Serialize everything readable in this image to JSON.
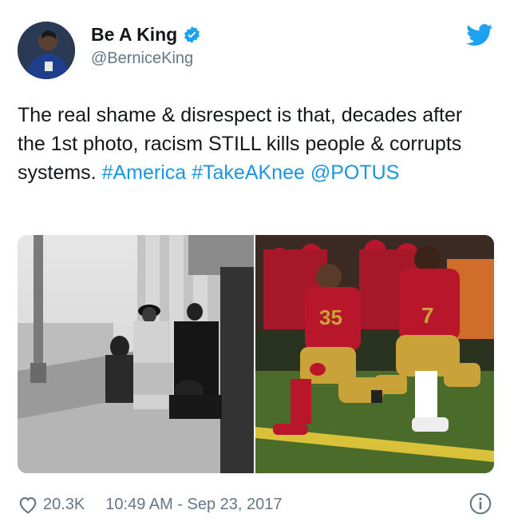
{
  "user": {
    "name": "Be A King",
    "handle": "@BerniceKing"
  },
  "tweet": {
    "text_plain": "The real shame & disrespect is that, decades after the 1st photo, racism STILL kills people & corrupts systems. ",
    "hashtag_1": "#America",
    "hashtag_2": "#TakeAKnee",
    "mention": "@POTUS"
  },
  "media": {
    "jersey_numbers": [
      "35",
      "7"
    ]
  },
  "footer": {
    "likes": "20.3K",
    "timestamp": "10:49 AM - Sep 23, 2017"
  },
  "icons": {
    "verified": "verified-badge-icon",
    "bird": "twitter-bird-icon",
    "heart": "heart-icon",
    "info": "info-icon"
  },
  "colors": {
    "link": "#1b95e0",
    "secondary_text": "#657786",
    "team_red": "#b8162b",
    "team_gold": "#c9a23a"
  }
}
